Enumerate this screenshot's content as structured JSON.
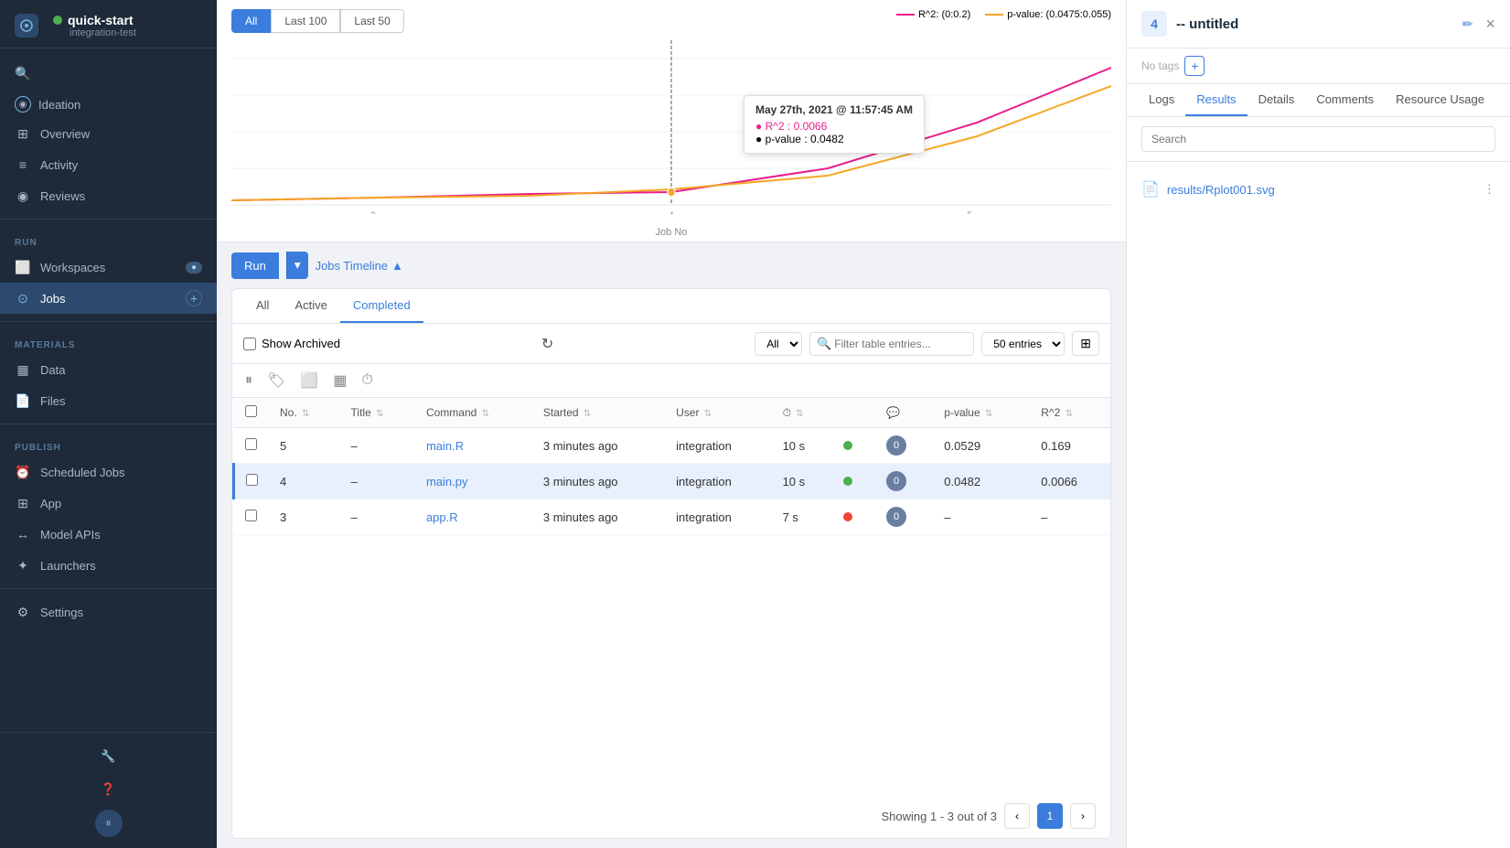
{
  "sidebar": {
    "project_dot_color": "#4caf50",
    "project_name": "quick-start",
    "project_sub": "integration-test",
    "ideation": "Ideation",
    "nav_items": [
      {
        "label": "Overview",
        "icon": "⊞",
        "active": false
      },
      {
        "label": "Activity",
        "icon": "≡",
        "active": false
      },
      {
        "label": "Reviews",
        "icon": "◉",
        "active": false
      }
    ],
    "run_section": "RUN",
    "run_items": [
      {
        "label": "Workspaces",
        "icon": "⬜",
        "badge": "",
        "active": false
      },
      {
        "label": "Jobs",
        "icon": "⊙",
        "badge": "+",
        "active": true
      }
    ],
    "materials_section": "MATERIALS",
    "materials_items": [
      {
        "label": "Data",
        "icon": "▦",
        "active": false
      },
      {
        "label": "Files",
        "icon": "📄",
        "active": false
      }
    ],
    "publish_section": "PUBLISH",
    "publish_items": [
      {
        "label": "Scheduled Jobs",
        "icon": "⏰",
        "active": false
      },
      {
        "label": "App",
        "icon": "⬛",
        "active": false
      },
      {
        "label": "Model APIs",
        "icon": "↔",
        "active": false
      },
      {
        "label": "Launchers",
        "icon": "✦",
        "active": false
      }
    ],
    "settings": "Settings"
  },
  "chart": {
    "all_btn": "All",
    "last100_btn": "Last 100",
    "last50_btn": "Last 50",
    "x_label": "Job No",
    "legend_r2": "R^2: (0:0.2)",
    "legend_pvalue": "p-value: (0.0475:0.055)",
    "tooltip_date": "May 27th, 2021 @ 11:57:45 AM",
    "tooltip_r2": "R^2 : 0.0066",
    "tooltip_pvalue": "p-value : 0.0482",
    "x_ticks": [
      "3",
      "4",
      "5"
    ]
  },
  "jobs": {
    "run_btn": "Run",
    "timeline_btn": "Jobs Timeline",
    "tabs": [
      "All",
      "Active",
      "Completed"
    ],
    "active_tab": "Completed",
    "show_archived": "Show Archived",
    "icon_bar": [
      "⏸",
      "🏷",
      "⬜",
      "▦",
      "⏱"
    ],
    "filter_all": "All",
    "search_placeholder": "Filter table entries...",
    "entries": "50 entries",
    "columns_icon": "⊞",
    "table": {
      "headers": [
        "No.",
        "Title",
        "Command",
        "Started",
        "User",
        "⏱",
        "",
        "💬",
        "p-value",
        "R^2"
      ],
      "rows": [
        {
          "no": "5",
          "title": "–",
          "command": "main.R",
          "started": "3 minutes ago",
          "user": "integration",
          "time": "10 s",
          "status": "green",
          "count": "0",
          "pvalue": "0.0529",
          "r2": "0.169"
        },
        {
          "no": "4",
          "title": "–",
          "command": "main.py",
          "started": "3 minutes ago",
          "user": "integration",
          "time": "10 s",
          "status": "green",
          "count": "0",
          "pvalue": "0.0482",
          "r2": "0.0066",
          "selected": true
        },
        {
          "no": "3",
          "title": "–",
          "command": "app.R",
          "started": "3 minutes ago",
          "user": "integration",
          "time": "7 s",
          "status": "red",
          "count": "0",
          "pvalue": "–",
          "r2": "–"
        }
      ]
    },
    "pagination": {
      "showing": "Showing 1 - 3 out of 3",
      "current_page": "1"
    }
  },
  "panel": {
    "job_number": "4",
    "job_title": "-- untitled",
    "no_tags": "No tags",
    "tabs": [
      "Logs",
      "Results",
      "Details",
      "Comments",
      "Resource Usage"
    ],
    "active_tab": "Results",
    "search_placeholder": "Search",
    "file": "results/Rplot001.svg",
    "close_icon": "×",
    "edit_icon": "✏"
  }
}
